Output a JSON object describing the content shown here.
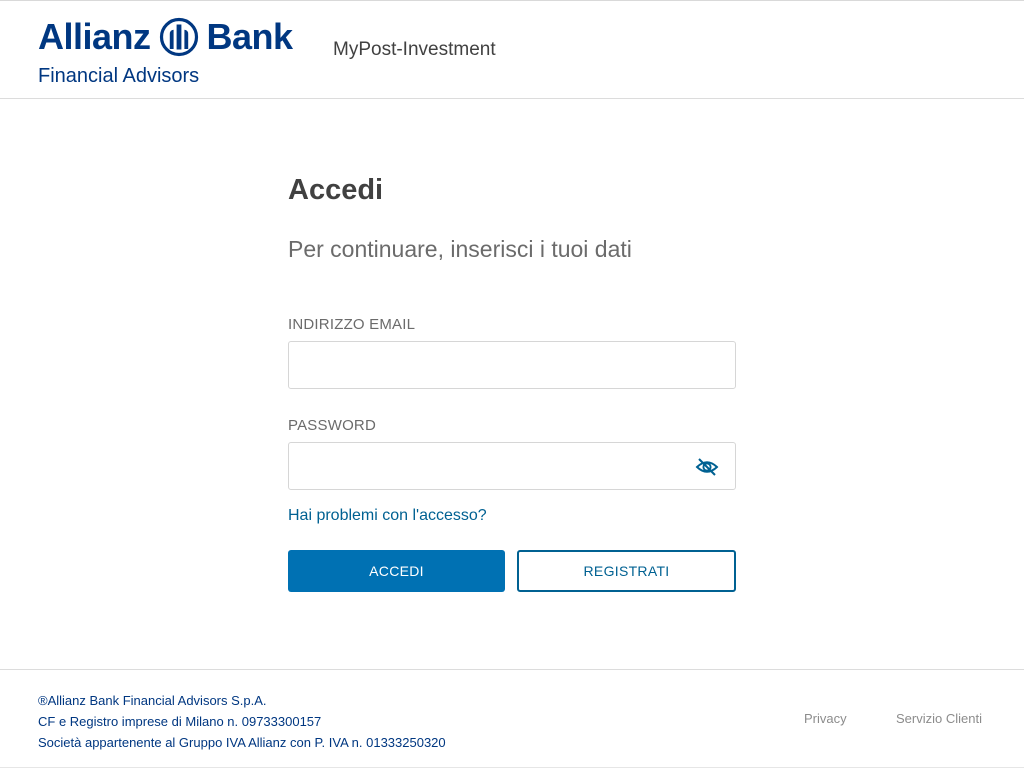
{
  "header": {
    "logo": {
      "word_left": "Allianz",
      "word_right": "Bank",
      "subline": "Financial Advisors",
      "brand_color": "#003781"
    },
    "app_name": "MyPost-Investment"
  },
  "login": {
    "title": "Accedi",
    "subtitle": "Per continuare, inserisci i tuoi dati",
    "email": {
      "label": "INDIRIZZO EMAIL",
      "value": "",
      "placeholder": ""
    },
    "password": {
      "label": "PASSWORD",
      "value": "",
      "placeholder": "",
      "toggle_icon": "eye-slash-icon"
    },
    "forgot_link": "Hai problemi con l'accesso?",
    "submit_label": "ACCEDI",
    "register_label": "REGISTRATI",
    "accent_color": "#0071b3"
  },
  "footer": {
    "legal_lines": [
      "®Allianz Bank Financial Advisors S.p.A.",
      "CF e Registro imprese di Milano n. 09733300157",
      "Società appartenente al Gruppo IVA Allianz con P. IVA n. 01333250320"
    ],
    "links": [
      "Privacy",
      "Servizio Clienti"
    ]
  }
}
